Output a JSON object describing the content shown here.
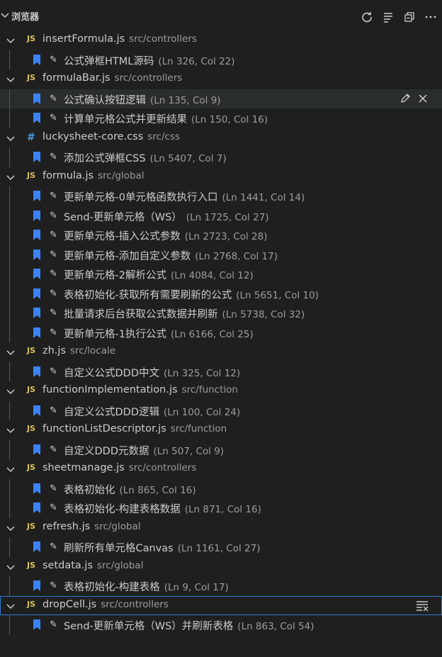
{
  "header": {
    "title": "浏览器"
  },
  "groups": [
    {
      "file": "insertFormula.js",
      "path": "src/controllers",
      "type": "JS",
      "marks": [
        {
          "label": "公式弹框HTML源码",
          "pos": "(Ln 326, Col 22)"
        }
      ]
    },
    {
      "file": "formulaBar.js",
      "path": "src/controllers",
      "type": "JS",
      "marks": [
        {
          "label": "公式确认按钮逻辑",
          "pos": "(Ln 135, Col 9)"
        },
        {
          "label": "计算单元格公式并更新结果",
          "pos": "(Ln 150, Col 16)"
        }
      ]
    },
    {
      "file": "luckysheet-core.css",
      "path": "src/css",
      "type": "#",
      "marks": [
        {
          "label": "添加公式弹框CSS",
          "pos": "(Ln 5407, Col 7)"
        }
      ]
    },
    {
      "file": "formula.js",
      "path": "src/global",
      "type": "JS",
      "marks": [
        {
          "label": "更新单元格-0单元格函数执行入口",
          "pos": "(Ln 1441, Col 14)"
        },
        {
          "label": "Send-更新单元格（WS）",
          "pos": "(Ln 1725, Col 27)"
        },
        {
          "label": "更新单元格-插入公式参数",
          "pos": "(Ln 2723, Col 28)"
        },
        {
          "label": "更新单元格-添加自定义参数",
          "pos": "(Ln 2768, Col 17)"
        },
        {
          "label": "更新单元格-2解析公式",
          "pos": "(Ln 4084, Col 12)"
        },
        {
          "label": "表格初始化-获取所有需要刷新的公式",
          "pos": "(Ln 5651, Col 10)"
        },
        {
          "label": "批量请求后台获取公式数据并刷新",
          "pos": "(Ln 5738, Col 32)"
        },
        {
          "label": "更新单元格-1执行公式",
          "pos": "(Ln 6166, Col 25)"
        }
      ]
    },
    {
      "file": "zh.js",
      "path": "src/locale",
      "type": "JS",
      "marks": [
        {
          "label": "自定义公式DDD中文",
          "pos": "(Ln 325, Col 12)"
        }
      ]
    },
    {
      "file": "functionImplementation.js",
      "path": "src/function",
      "type": "JS",
      "marks": [
        {
          "label": "自定义公式DDD逻辑",
          "pos": "(Ln 100, Col 24)"
        }
      ]
    },
    {
      "file": "functionListDescriptor.js",
      "path": "src/function",
      "type": "JS",
      "marks": [
        {
          "label": "自定义DDD元数据",
          "pos": "(Ln 507, Col 9)"
        }
      ]
    },
    {
      "file": "sheetmanage.js",
      "path": "src/controllers",
      "type": "JS",
      "marks": [
        {
          "label": "表格初始化",
          "pos": "(Ln 865, Col 16)"
        },
        {
          "label": "表格初始化-构建表格数据",
          "pos": "(Ln 871, Col 16)"
        }
      ]
    },
    {
      "file": "refresh.js",
      "path": "src/global",
      "type": "JS",
      "marks": [
        {
          "label": "刷新所有单元格Canvas",
          "pos": "(Ln 1161, Col 27)"
        }
      ]
    },
    {
      "file": "setdata.js",
      "path": "src/global",
      "type": "JS",
      "marks": [
        {
          "label": "表格初始化-构建表格",
          "pos": "(Ln 9, Col 17)"
        }
      ]
    },
    {
      "file": "dropCell.js",
      "path": "src/controllers",
      "type": "JS",
      "marks": [
        {
          "label": "Send-更新单元格（WS）并刷新表格",
          "pos": "(Ln 863, Col 54)"
        }
      ]
    }
  ],
  "state": {
    "hover_mark": "1.0",
    "selected_file": "10"
  },
  "colors": {
    "bookmark": "#3b82f6",
    "js": "#d8c457",
    "css": "#4d9ae5"
  },
  "icons": [
    "refresh-icon",
    "collapse-all-icon",
    "open-editors-icon",
    "more-icon",
    "bookmark-icon",
    "pencil-icon",
    "close-icon",
    "clear-all-icon"
  ]
}
